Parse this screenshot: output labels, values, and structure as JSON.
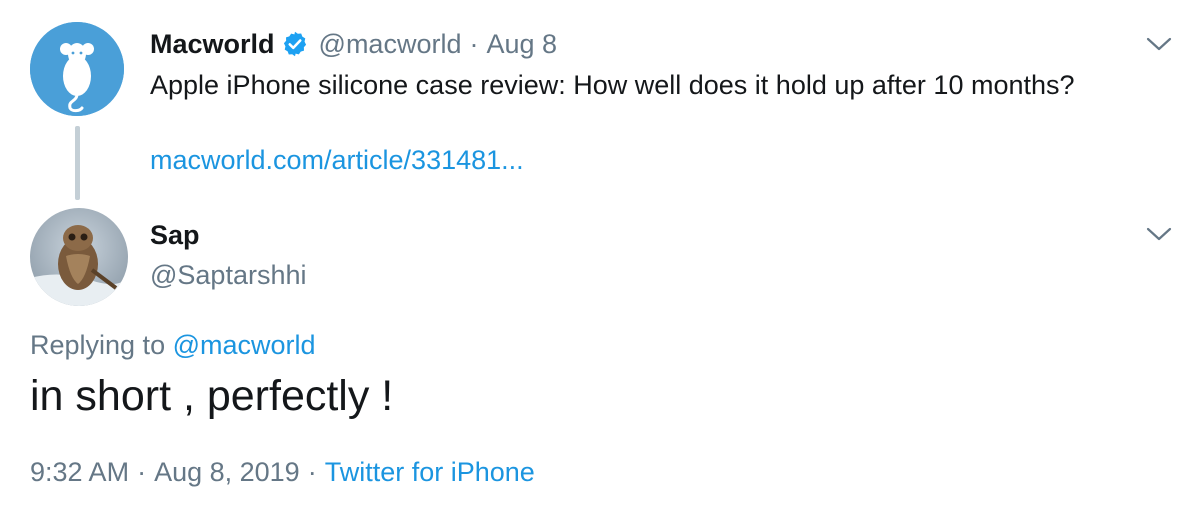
{
  "tweet": {
    "name": "Macworld",
    "handle": "@macworld",
    "separator": "·",
    "date": "Aug 8",
    "text": "Apple iPhone silicone case review: How well does it hold up after 10 months?",
    "link": "macworld.com/article/331481..."
  },
  "reply": {
    "name": "Sap",
    "handle": "@Saptarshhi",
    "replying_prefix": "Replying to",
    "replying_to": "@macworld",
    "text": "in short , perfectly !",
    "time": "9:32 AM",
    "separator": "·",
    "full_date": "Aug 8, 2019",
    "source": "Twitter for iPhone"
  },
  "icons": {
    "verified": "verified-badge-icon",
    "menu": "chevron-down-icon"
  },
  "colors": {
    "link": "#1b95e0",
    "secondary_text": "#657786",
    "verified": "#1da1f2",
    "macworld_avatar": "#4a9fd8",
    "thread_line": "#c4cfd6"
  }
}
